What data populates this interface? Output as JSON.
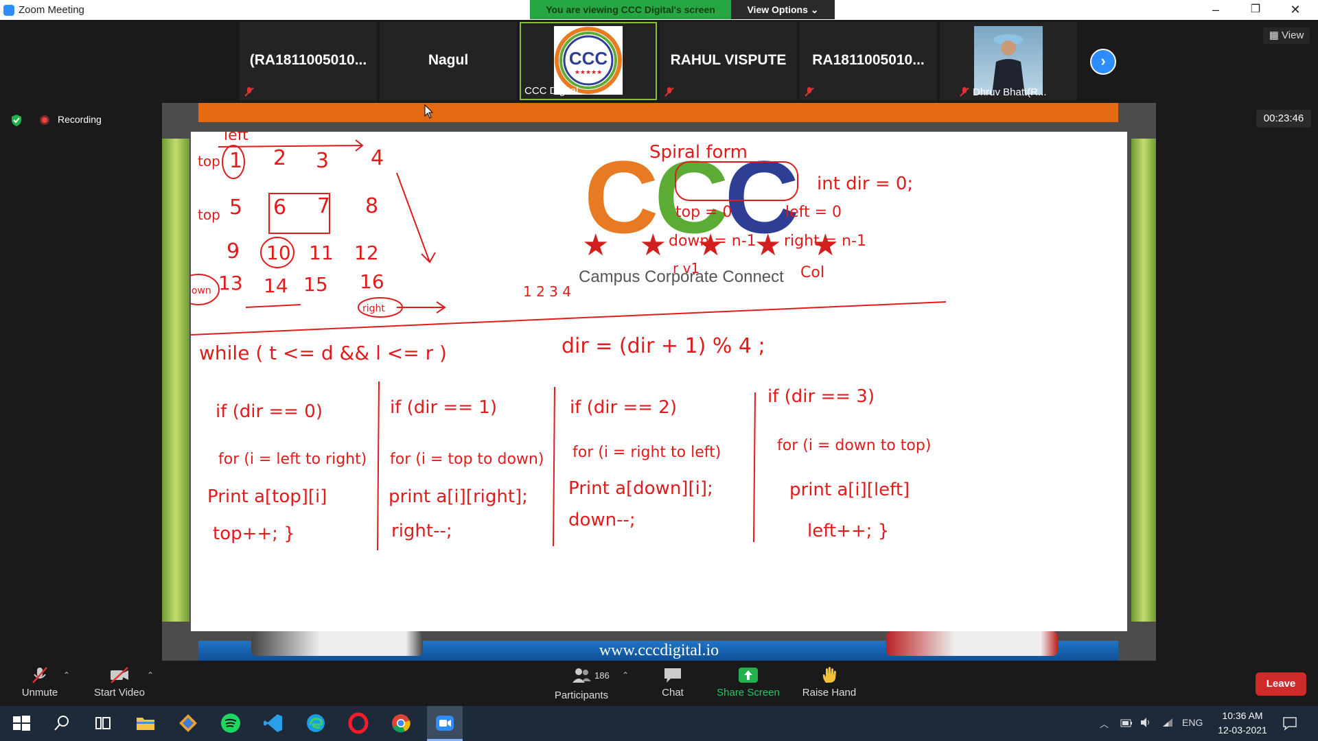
{
  "window": {
    "title": "Zoom Meeting",
    "minimize": "–",
    "restore": "❐",
    "close": "✕"
  },
  "share_banner": {
    "viewing_text": "You are viewing CCC Digital's screen",
    "view_options": "View Options ⌄"
  },
  "participants": [
    {
      "name": "(RA1811005010...",
      "muted": true
    },
    {
      "name": "Nagul",
      "muted": false
    },
    {
      "name": "CCC Digital",
      "muted": false,
      "active": true
    },
    {
      "name": "RAHUL VISPUTE",
      "muted": true
    },
    {
      "name": "RA1811005010...",
      "muted": true
    },
    {
      "name": "Dhruv Bhatt(R...",
      "muted": true
    }
  ],
  "view_button": "View",
  "recording_label": "Recording",
  "timer": "00:23:46",
  "board": {
    "logo_letters": [
      "C",
      "C",
      "C"
    ],
    "stars": "★ ★ ★ ★ ★",
    "tagline": "Campus Corporate Connect",
    "url": "www.cccdigital.io",
    "notes": {
      "top_label": "left",
      "spiral_title": "Spiral form",
      "int_dir": "int dir = 0;",
      "top_eq": "top = 0",
      "left_eq": "left = 0",
      "down_eq": "down = n-1",
      "right_eq": "right = n-1",
      "rv": "r v1",
      "col": "Col",
      "seq": "1 2 3 4",
      "dir_update": "dir = (dir + 1) % 4 ;",
      "while": "while ( t <= d && l <= r )",
      "if0": "if (dir == 0)",
      "for0": "for (i = left to right)",
      "print0": "Print a[top][i]",
      "top_pp": "top++; }",
      "if1": "if (dir == 1)",
      "for1": "for (i = top to down)",
      "print1": "print a[i][right];",
      "right_mm": "right--;",
      "if2": "if (dir == 2)",
      "for2": "for (i = right to left)",
      "print2": "Print a[down][i];",
      "down_mm": "down--;",
      "if3": "if (dir == 3)",
      "for3": "for (i = down to top)",
      "print3": "print a[i][left]",
      "left_pp": "left++; }",
      "matrix": [
        "1",
        "2",
        "3",
        "4",
        "5",
        "6",
        "7",
        "8",
        "9",
        "10",
        "11",
        "12",
        "13",
        "14",
        "15",
        "16"
      ],
      "labels": {
        "top": "top",
        "down": "down",
        "right": "right"
      }
    }
  },
  "toolbar": {
    "unmute": "Unmute",
    "start_video": "Start Video",
    "participants": "Participants",
    "participants_count": "186",
    "chat": "Chat",
    "share_screen": "Share Screen",
    "raise_hand": "Raise Hand",
    "leave": "Leave"
  },
  "taskbar": {
    "lang": "ENG",
    "time": "10:36 AM",
    "date": "12-03-2021"
  }
}
